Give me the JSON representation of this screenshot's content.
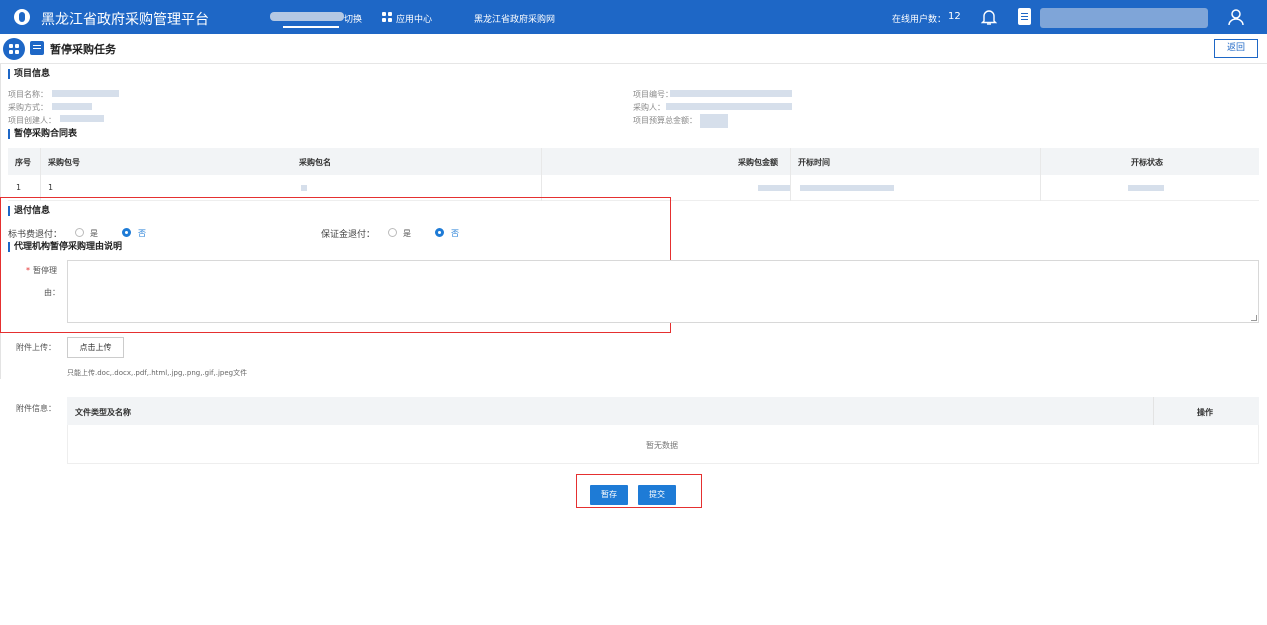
{
  "topbar": {
    "app_title": "黑龙江省政府采购管理平台",
    "switch_label": "切换",
    "app_center": "应用中心",
    "portal_link": "黑龙江省政府采购网",
    "online_users_label": "在线用户数：",
    "online_users_count": "12"
  },
  "page": {
    "title": "暂停采购任务",
    "back_label": "返回"
  },
  "project_info": {
    "section_title": "项目信息",
    "name_label": "项目名称：",
    "method_label": "采购方式：",
    "creator_label": "项目创建人：",
    "code_label": "项目编号：",
    "purchaser_label": "采购人：",
    "budget_label": "项目预算总金额："
  },
  "contract_table": {
    "section_title": "暂停采购合同表",
    "headers": [
      "序号",
      "采购包号",
      "采购包名",
      "采购包金额",
      "开标时间",
      "开标状态"
    ],
    "rows": [
      {
        "index": "1",
        "package_no": "1"
      }
    ]
  },
  "refund": {
    "section_title": "退付信息",
    "doc_fee_label": "标书费退付：",
    "deposit_label": "保证金退付：",
    "yes": "是",
    "no": "否",
    "doc_fee_selected": "否",
    "deposit_selected": "否"
  },
  "reason": {
    "section_title": "代理机构暂停采购理由说明",
    "required_mark": "*",
    "label_line1": "暂停理",
    "label_line2": "由：",
    "value": ""
  },
  "attachment": {
    "upload_label": "附件上传：",
    "upload_button": "点击上传",
    "upload_hint": "只能上传.doc,.docx,.pdf,.html,.jpg,.png,.gif,.jpeg文件",
    "info_label": "附件信息：",
    "col_name": "文件类型及名称",
    "col_action": "操作",
    "empty_text": "暂无数据"
  },
  "actions": {
    "save_label": "暂存",
    "submit_label": "提交"
  },
  "colors": {
    "brand_blue": "#1e67c6",
    "accent_blue": "#1e7bd6",
    "highlight_red": "#e53030"
  }
}
